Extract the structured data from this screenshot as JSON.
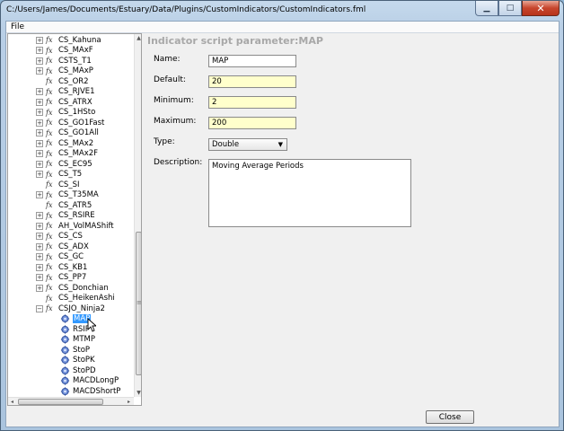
{
  "window": {
    "title": "C:/Users/James/Documents/Estuary/Data/Plugins/CustomIndicators/CustomIndicators.fml",
    "minimize_glyph": "▁",
    "maximize_glyph": "□",
    "close_glyph": "✕"
  },
  "menu": {
    "file_label": "File"
  },
  "tree": {
    "items": [
      {
        "label": "CS_Kahuna",
        "expander": "⊞"
      },
      {
        "label": "CS_MAxF",
        "expander": "⊞"
      },
      {
        "label": "CSTS_T1",
        "expander": "⊞"
      },
      {
        "label": "CS_MAxP",
        "expander": "⊞"
      },
      {
        "label": "CS_OR2",
        "expander": ""
      },
      {
        "label": "CS_RJVE1",
        "expander": "⊞"
      },
      {
        "label": "CS_ATRX",
        "expander": "⊞"
      },
      {
        "label": "CS_1HSto",
        "expander": "⊞"
      },
      {
        "label": "CS_GO1Fast",
        "expander": "⊞"
      },
      {
        "label": "CS_GO1All",
        "expander": "⊞"
      },
      {
        "label": "CS_MAx2",
        "expander": "⊞"
      },
      {
        "label": "CS_MAx2F",
        "expander": "⊞"
      },
      {
        "label": "CS_EC95",
        "expander": "⊞"
      },
      {
        "label": "CS_T5",
        "expander": "⊞"
      },
      {
        "label": "CS_SI",
        "expander": ""
      },
      {
        "label": "CS_T35MA",
        "expander": "⊞"
      },
      {
        "label": "CS_ATR5",
        "expander": ""
      },
      {
        "label": "CS_RSIRE",
        "expander": "⊞"
      },
      {
        "label": "AH_VolMAShift",
        "expander": "⊞"
      },
      {
        "label": "CS_CS",
        "expander": "⊞"
      },
      {
        "label": "CS_ADX",
        "expander": "⊞"
      },
      {
        "label": "CS_GC",
        "expander": "⊞"
      },
      {
        "label": "CS_KB1",
        "expander": "⊞"
      },
      {
        "label": "CS_PP7",
        "expander": "⊞"
      },
      {
        "label": "CS_Donchian",
        "expander": "⊞"
      },
      {
        "label": "CS_HeikenAshi",
        "expander": ""
      },
      {
        "label": "CSJO_Ninja2",
        "expander": "⊟"
      }
    ],
    "children": [
      {
        "label": "MAP",
        "selected": true
      },
      {
        "label": "RSIP"
      },
      {
        "label": "MTMP"
      },
      {
        "label": "StoP"
      },
      {
        "label": "StoPK"
      },
      {
        "label": "StoPD"
      },
      {
        "label": "MACDLongP"
      },
      {
        "label": "MACDShortP"
      }
    ],
    "scroll_up": "▲",
    "scroll_down": "▼",
    "scroll_left": "◂",
    "scroll_right": "▸",
    "grip": "≡"
  },
  "editor": {
    "title": "Indicator script parameter:MAP",
    "name_label": "Name:",
    "name_value": "MAP",
    "default_label": "Default:",
    "default_value": "20",
    "minimum_label": "Minimum:",
    "minimum_value": "2",
    "maximum_label": "Maximum:",
    "maximum_value": "200",
    "type_label": "Type:",
    "type_value": "Double",
    "description_label": "Description:",
    "description_value": "Moving Average Periods"
  },
  "footer": {
    "close_label": "Close"
  }
}
